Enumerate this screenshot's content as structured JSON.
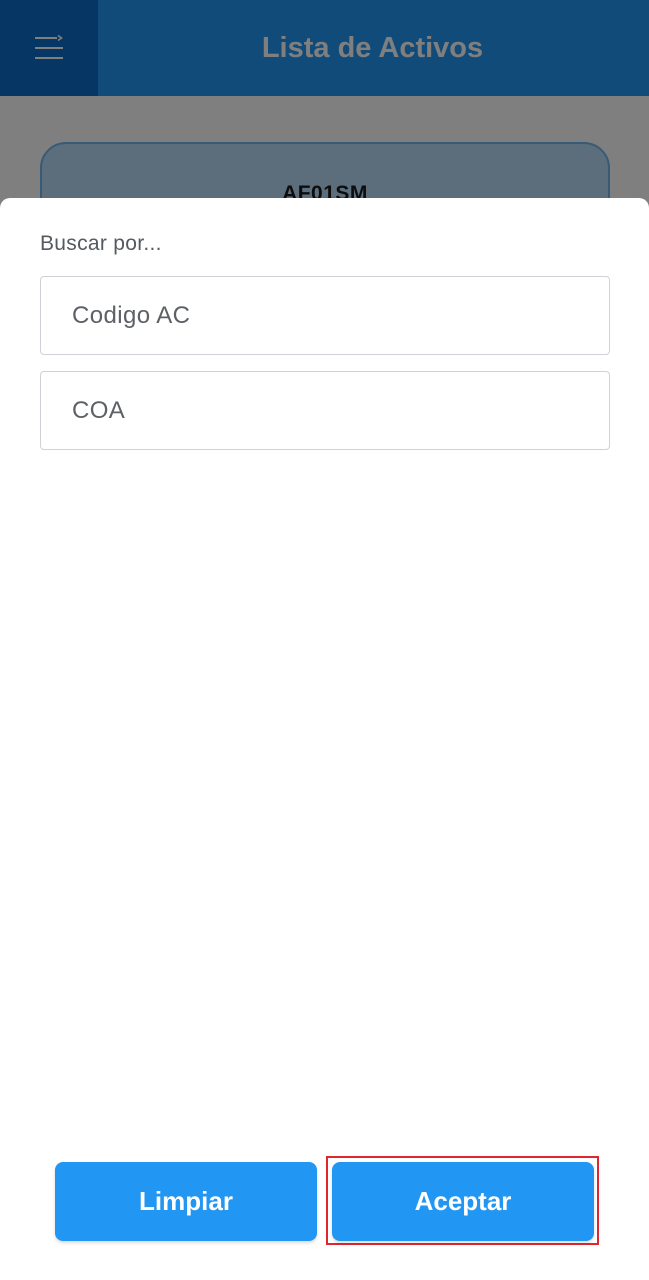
{
  "appbar": {
    "title": "Lista de Activos",
    "menu_icon": "menu-icon"
  },
  "background": {
    "asset_code": "AF01SM"
  },
  "search_sheet": {
    "label": "Buscar por...",
    "fields": [
      {
        "placeholder": "Codigo AC",
        "value": ""
      },
      {
        "placeholder": "COA",
        "value": ""
      }
    ],
    "buttons": {
      "clear_label": "Limpiar",
      "accept_label": "Aceptar"
    }
  },
  "colors": {
    "primary": "#2196f3",
    "primary_dark": "#0d6fc8",
    "highlight": "#e0262f"
  }
}
